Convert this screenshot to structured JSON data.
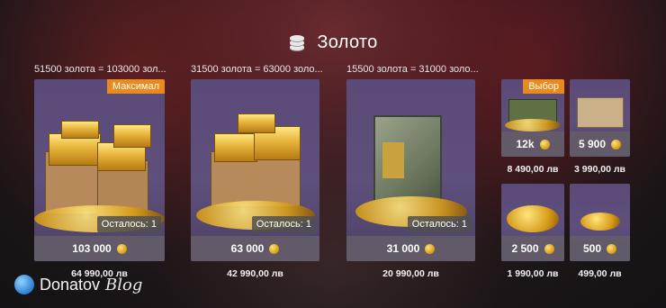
{
  "header": {
    "title": "Золото",
    "icon": "coin-stack-icon"
  },
  "large_offers": [
    {
      "label": "51500 золота = 103000 зол...",
      "badge": "Максимал",
      "remaining": "Осталось: 1",
      "amount": "103 000",
      "price": "64 990,00 лв"
    },
    {
      "label": "31500 золота = 63000 золо...",
      "badge": "",
      "remaining": "Осталось: 1",
      "amount": "63 000",
      "price": "42 990,00 лв"
    },
    {
      "label": "15500 золота = 31000 золо...",
      "badge": "",
      "remaining": "Осталось: 1",
      "amount": "31 000",
      "price": "20 990,00 лв"
    }
  ],
  "small_offers": [
    {
      "badge": "Выбор",
      "amount": "12k",
      "price": "8 490,00 лв"
    },
    {
      "badge": "",
      "amount": "5 900",
      "price": "3 990,00 лв"
    },
    {
      "badge": "",
      "amount": "2 500",
      "price": "1 990,00 лв"
    },
    {
      "badge": "",
      "amount": "500",
      "price": "499,00 лв"
    }
  ],
  "watermark": {
    "brand": "Donatov",
    "suffix": "Blog"
  },
  "colors": {
    "badge": "#e88a1d",
    "tile": "#5a4a78",
    "gold": "#e6b33a"
  }
}
